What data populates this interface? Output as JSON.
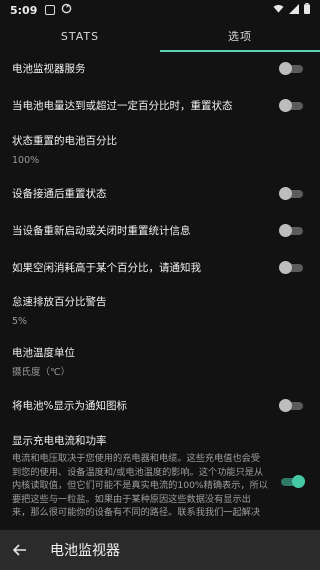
{
  "status_bar": {
    "time": "5:09"
  },
  "tabs": [
    {
      "label": "STATS",
      "active": false
    },
    {
      "label": "选项",
      "active": true
    }
  ],
  "settings": [
    {
      "title": "电池监视器服务",
      "toggle": false
    },
    {
      "title": "当电池电量达到或超过一定百分比时，重置状态",
      "toggle": false
    },
    {
      "title": "状态重置的电池百分比",
      "value": "100%"
    },
    {
      "title": "设备接通后重置状态",
      "toggle": false
    },
    {
      "title": "当设备重新启动或关闭时重置统计信息",
      "toggle": false
    },
    {
      "title": "如果空闲消耗高于某个百分比，请通知我",
      "toggle": false
    },
    {
      "title": "怠速排放百分比警告",
      "value": "5%"
    },
    {
      "title": "电池温度单位",
      "value": "摄氏度（℃）"
    },
    {
      "title": "将电池%显示为通知图标",
      "toggle": false
    },
    {
      "title": "显示充电电流和功率",
      "description": "电流和电压取决于您使用的充电器和电缆。这些充电值也会受到您的使用、设备温度和/或电池温度的影响。这个功能只是从内核读取值，但它们可能不是真实电流的100%精确表示，所以要把这些与一粒盐。如果由于某种原因这些数据没有显示出来，那么很可能你的设备有不同的路径。联系我我们一起解决",
      "toggle": true
    }
  ],
  "bottom_bar": {
    "title": "电池监视器"
  },
  "colors": {
    "accent": "#45c9a4",
    "background": "#121212",
    "bar": "#2b2b2b"
  }
}
